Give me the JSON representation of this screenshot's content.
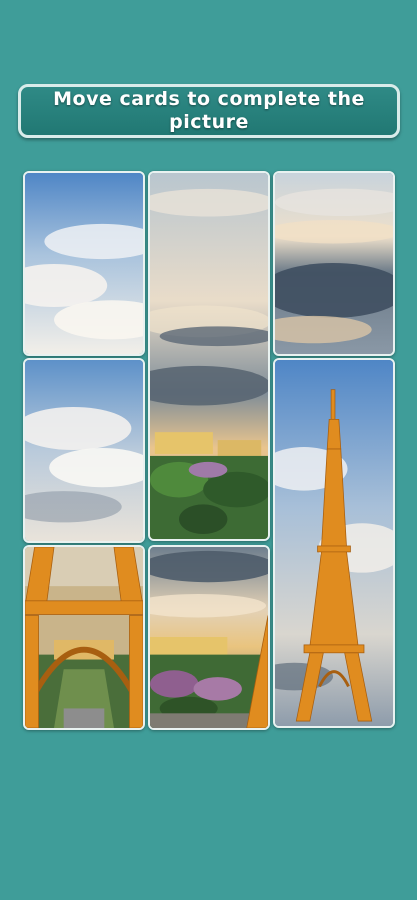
{
  "instruction": "Move cards to complete the picture",
  "board": {
    "cards": [
      {
        "id": "sky-top-left",
        "depicts": "blue sky with white clouds"
      },
      {
        "id": "sky-middle-tall",
        "depicts": "cloudy sky over city greenery"
      },
      {
        "id": "sky-top-right",
        "depicts": "dark clouds with sunlit edges"
      },
      {
        "id": "sky-middle-left",
        "depicts": "blue sky with white clouds"
      },
      {
        "id": "eiffel-tower-tall",
        "depicts": "Eiffel Tower against sky"
      },
      {
        "id": "tower-base",
        "depicts": "Eiffel Tower legs over Champ de Mars"
      },
      {
        "id": "city-bottom",
        "depicts": "clouds over trees and buildings"
      }
    ]
  },
  "colors": {
    "background": "#3f9d99",
    "banner": "#217873",
    "card_border": "#e9f2f1",
    "tower": "#e08c1f"
  }
}
